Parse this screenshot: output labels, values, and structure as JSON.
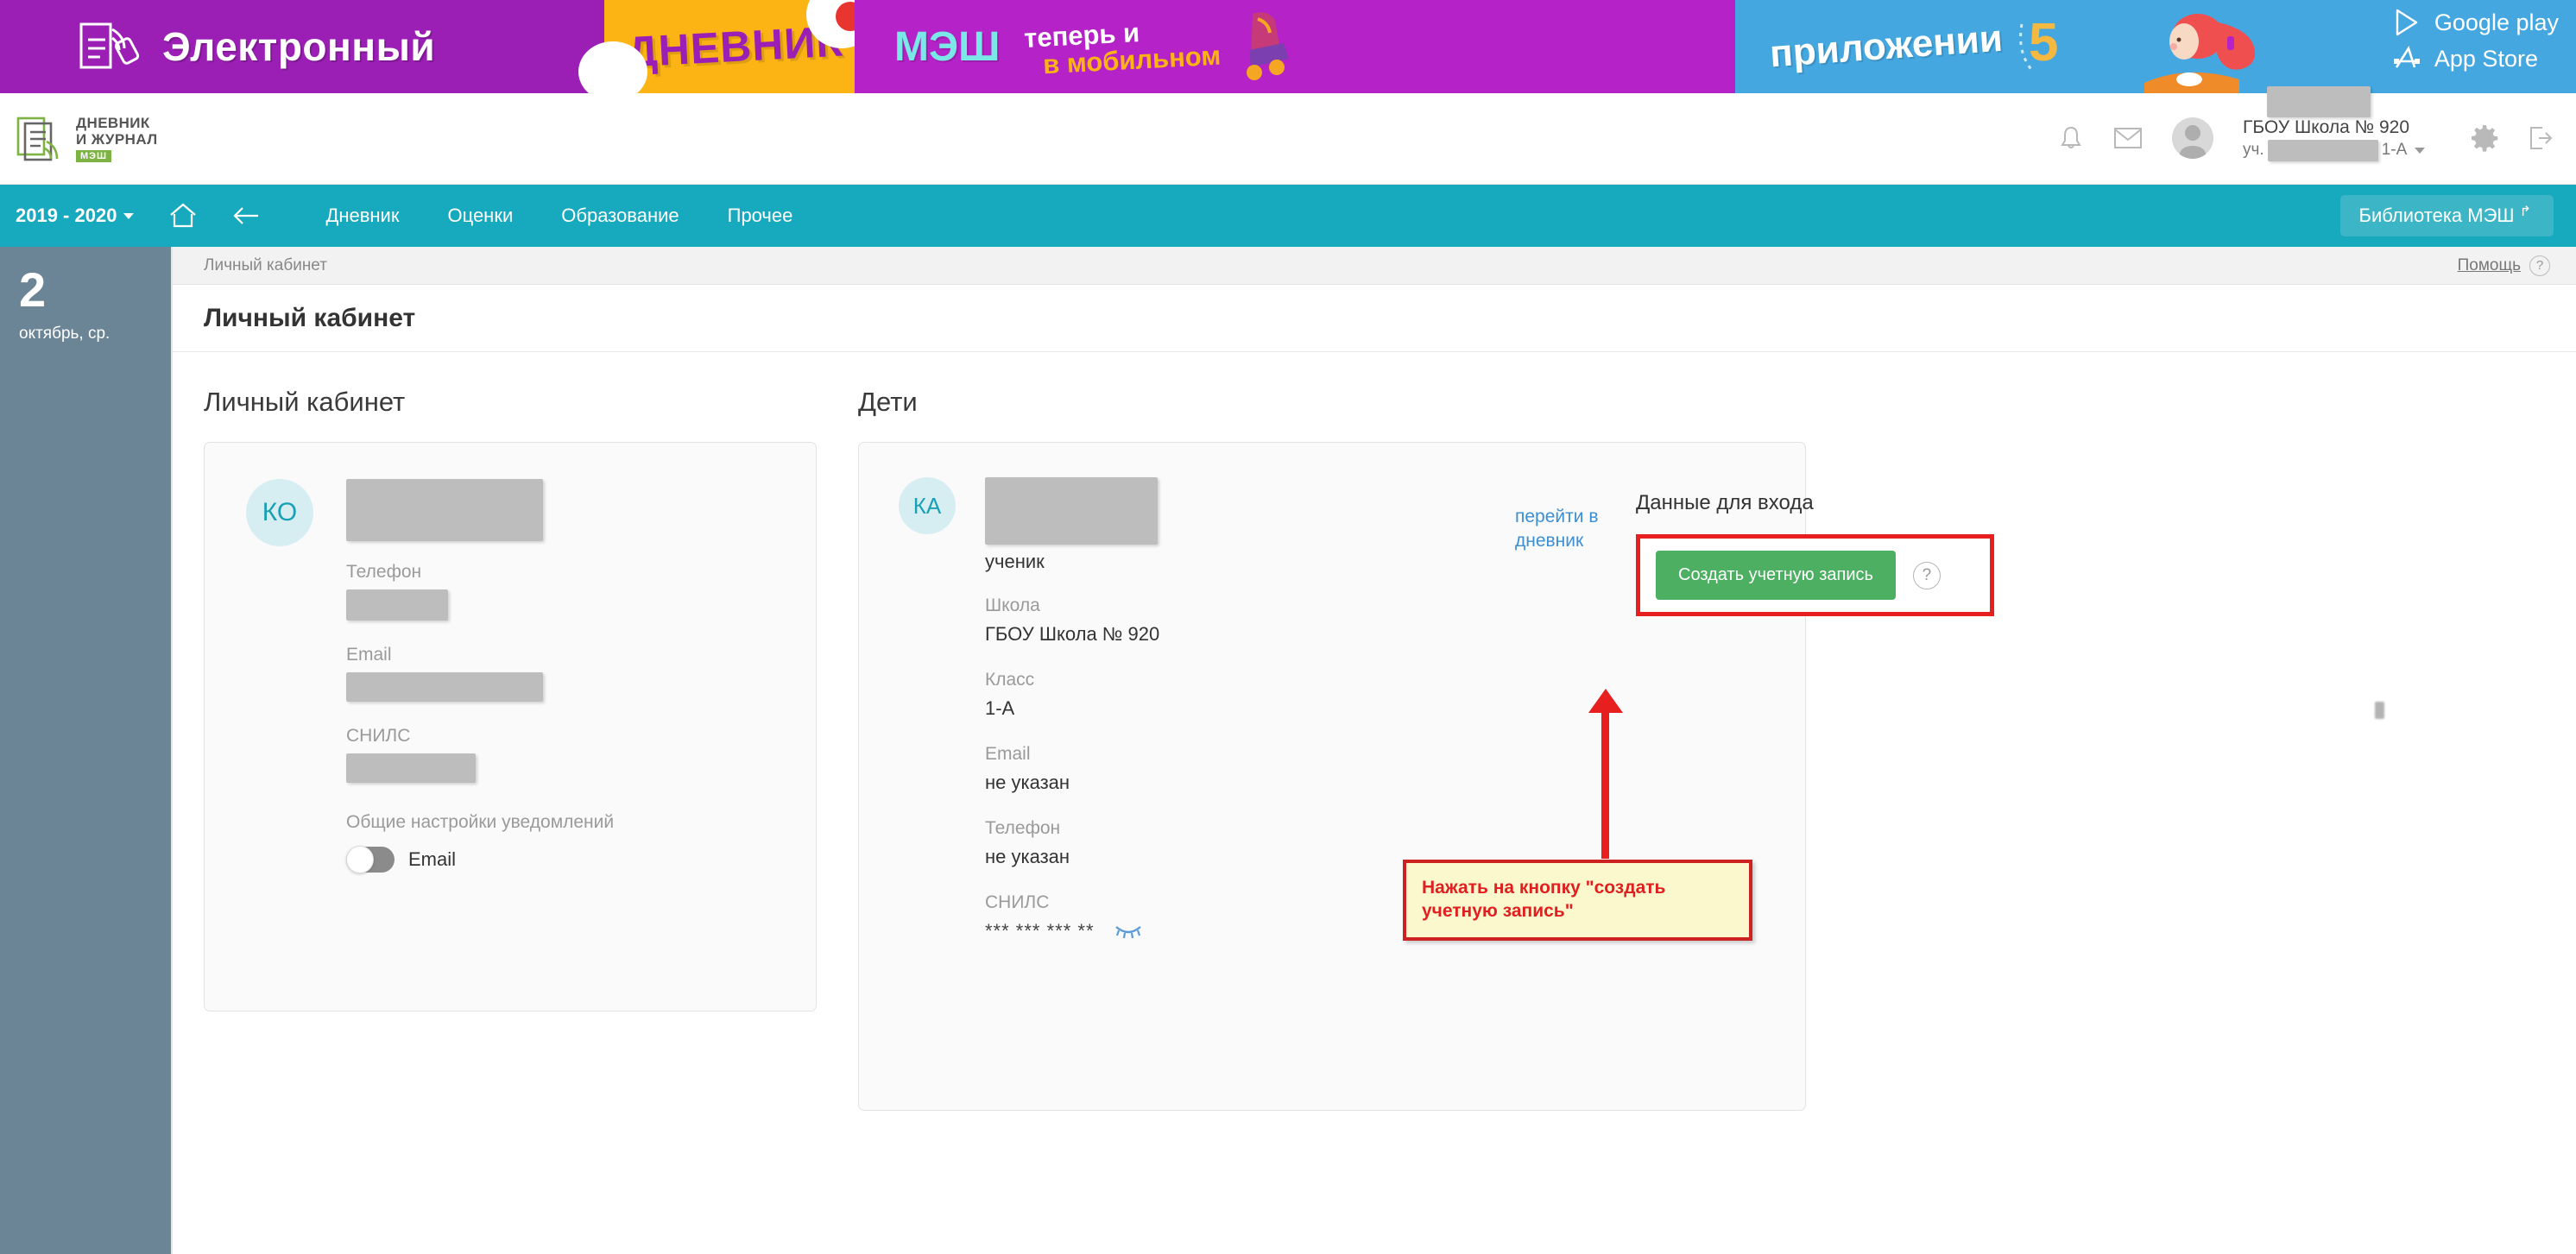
{
  "promo": {
    "word_electronic": "Электронный",
    "word_dnevnik": "ДНЕВНИК",
    "word_mesh": "МЭШ",
    "now_line1": "теперь и",
    "now_line2": "в мобильном",
    "word_app": "приложении",
    "google_play": "Google play",
    "app_store": "App Store"
  },
  "header": {
    "brand_line1": "ДНЕВНИК",
    "brand_line2": "И ЖУРНАЛ",
    "brand_badge": "МЭШ",
    "user_school": "ГБОУ Школа № 920",
    "user_prefix": "уч.",
    "user_class": "1-А"
  },
  "nav": {
    "year": "2019 - 2020",
    "links": [
      {
        "label": "Дневник"
      },
      {
        "label": "Оценки"
      },
      {
        "label": "Образование"
      },
      {
        "label": "Прочее"
      }
    ],
    "library_button": "Библиотека МЭШ"
  },
  "sidebar": {
    "day": "2",
    "month": "октябрь, ср."
  },
  "breadcrumb": "Личный кабинет",
  "help": {
    "label": "Помощь",
    "icon_glyph": "?"
  },
  "page_title": "Личный кабинет",
  "profile_panel": {
    "heading": "Личный кабинет",
    "initials": "КО",
    "fields": [
      {
        "label": "Телефон",
        "value": ""
      },
      {
        "label": "Email",
        "value": ""
      },
      {
        "label": "СНИЛС",
        "value": ""
      }
    ],
    "notifications_label": "Общие настройки уведомлений",
    "toggle_label": "Email",
    "toggle_state": "off"
  },
  "children_panel": {
    "heading": "Дети",
    "initials": "КА",
    "role": "ученик",
    "goto_link": "перейти в дневник",
    "fields": [
      {
        "label": "Школа",
        "value": "ГБОУ Школа № 920"
      },
      {
        "label": "Класс",
        "value": "1-А"
      },
      {
        "label": "Email",
        "value": "не указан"
      },
      {
        "label": "Телефон",
        "value": "не указан"
      },
      {
        "label": "СНИЛС",
        "value": "*** *** *** **"
      }
    ],
    "login_heading": "Данные для входа",
    "create_account_button": "Создать учетную запись",
    "help_glyph": "?"
  },
  "annotation": {
    "text": "Нажать на кнопку \"создать учетную запись\"",
    "border_color": "#cc2222",
    "fill_color": "#fcf8cd",
    "text_color": "#e02020",
    "highlight_color": "#e81f1f"
  },
  "colors": {
    "nav_teal": "#17a9bd",
    "sidebar_slate": "#6b8596",
    "accent_green": "#4caf62",
    "link_blue": "#3b8fd4",
    "initials_cyan": "#1aa0b5"
  }
}
